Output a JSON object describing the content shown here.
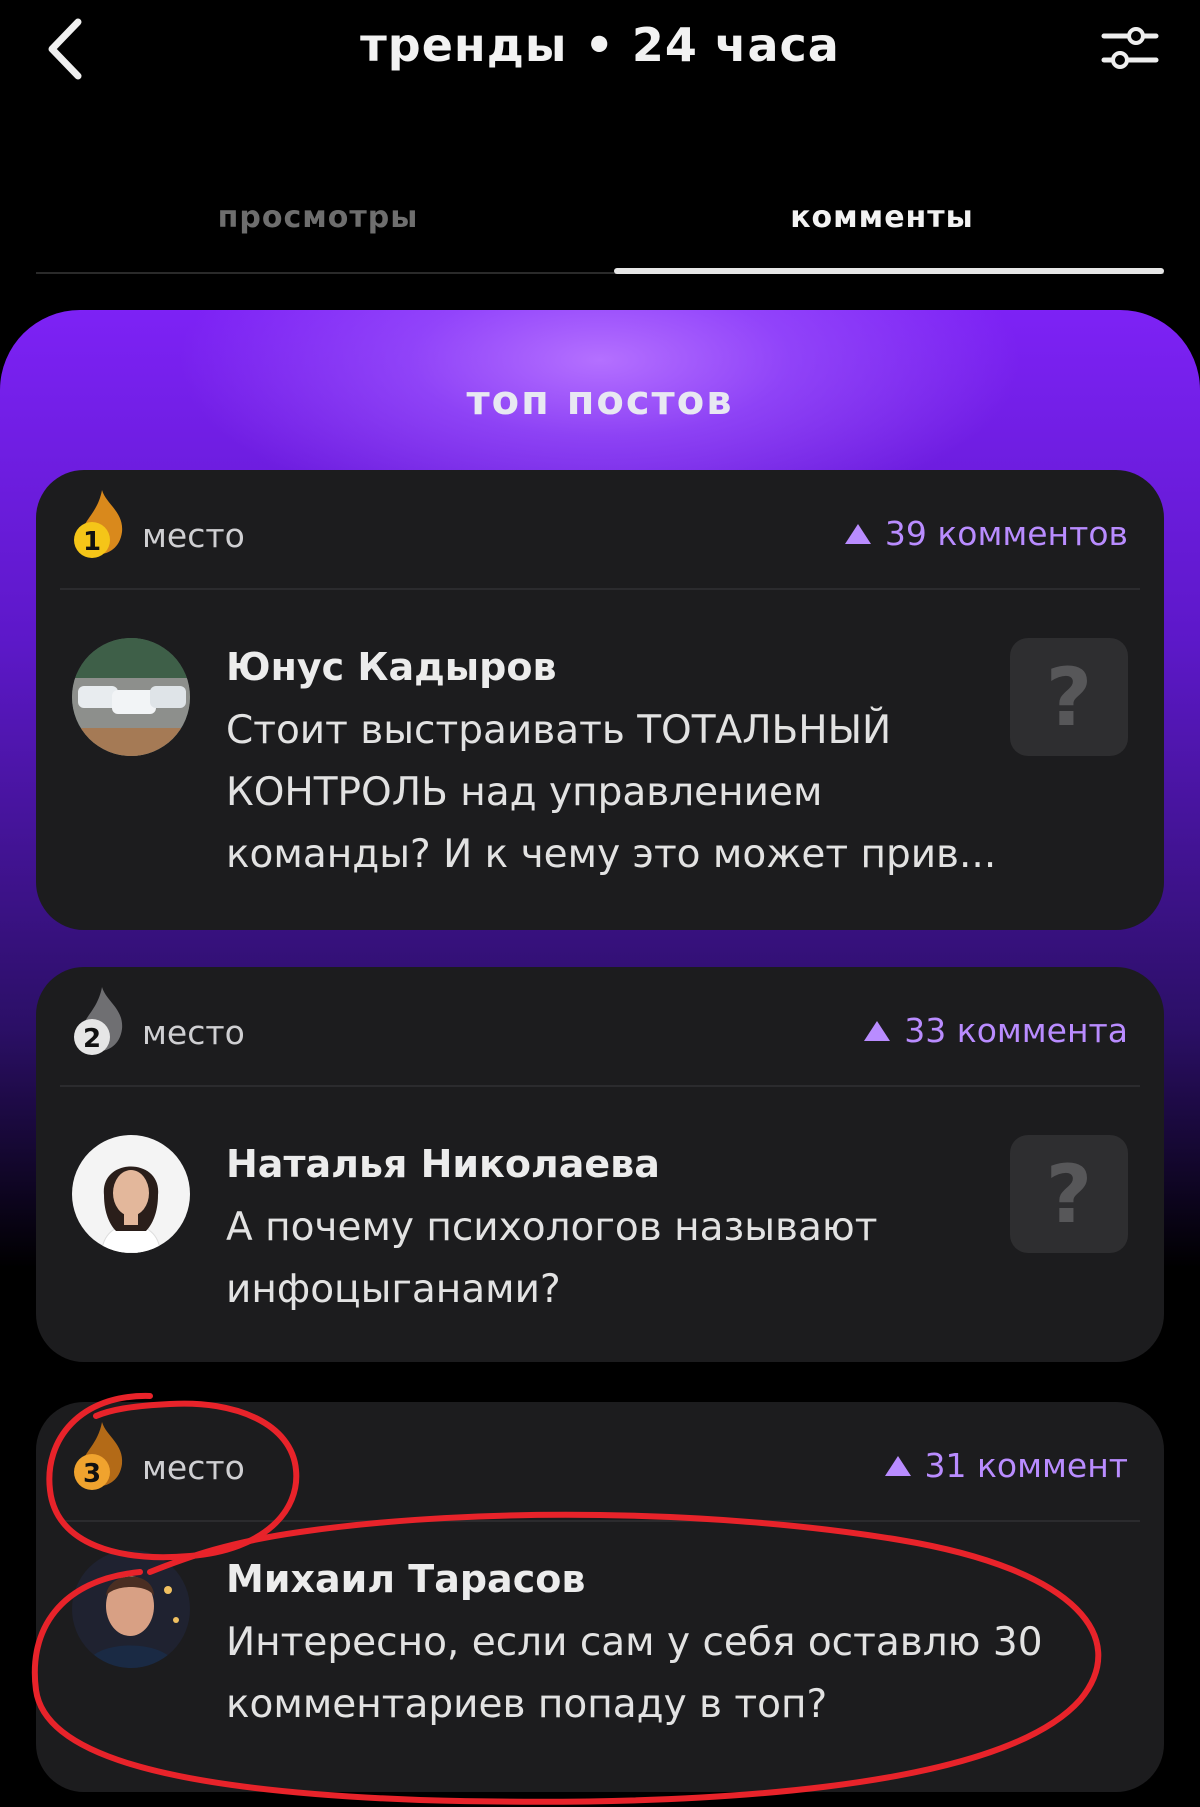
{
  "header": {
    "title": "тренды • 24 часа",
    "back_icon": "chevron-left-icon",
    "filter_icon": "sliders-icon"
  },
  "tabs": [
    {
      "label": "просмотры",
      "active": false
    },
    {
      "label": "комменты",
      "active": true
    }
  ],
  "section": {
    "title": "топ постов"
  },
  "posts": [
    {
      "place": "1",
      "place_label": "место",
      "count_text": "39 комментов",
      "author": "Юнус Кадыров",
      "text": "Стоит выстраивать ТОТАЛЬНЫЙ КОНТРОЛЬ над управлением команды? И к чему это может прив...",
      "thumb_glyph": "?",
      "badge_color": "#f5c518"
    },
    {
      "place": "2",
      "place_label": "место",
      "count_text": "33 коммента",
      "author": "Наталья Николаева",
      "text": "А почему психологов называют инфоцыганами?",
      "thumb_glyph": "?",
      "badge_color": "#e6e6e6"
    },
    {
      "place": "3",
      "place_label": "место",
      "count_text": "31 коммент",
      "author": "Михаил Тарасов",
      "text": "Интересно, если сам у себя оставлю 30 комментариев попаду в топ?",
      "badge_color": "#f0a32e"
    }
  ],
  "colors": {
    "accent": "#b98cff",
    "annotation": "#e8232a",
    "card": "#1c1c1e"
  }
}
